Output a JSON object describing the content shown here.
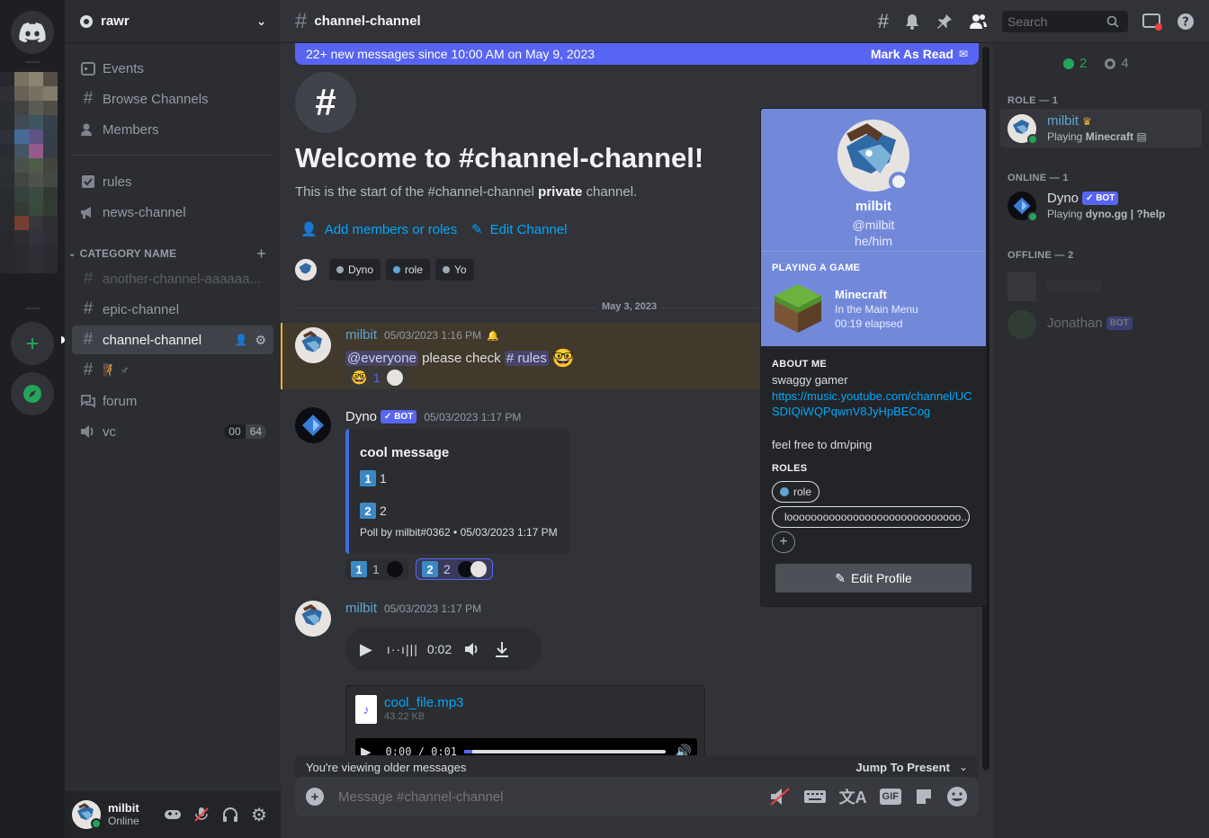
{
  "server": {
    "name": "rawr"
  },
  "sidebar": {
    "top_items": [
      {
        "label": "Events",
        "icon": "calendar-icon"
      },
      {
        "label": "Browse Channels",
        "icon": "browse-channels-icon"
      },
      {
        "label": "Members",
        "icon": "members-icon"
      }
    ],
    "channels": [
      {
        "label": "rules",
        "icon": "rules-icon"
      },
      {
        "label": "news-channel",
        "icon": "announcement-icon"
      }
    ],
    "category": {
      "label": "CATEGORY NAME"
    },
    "category_channels": [
      {
        "label": "another-channel-aaaaaa...",
        "muted": true
      },
      {
        "label": "epic-channel"
      },
      {
        "label": "channel-channel",
        "selected": true
      },
      {
        "label": "🧗 ♂"
      },
      {
        "label": "forum"
      },
      {
        "label": "vc",
        "vc_count": "00",
        "vc_limit": "64"
      }
    ]
  },
  "user_panel": {
    "name": "milbit",
    "status": "Online"
  },
  "topbar": {
    "channel": "channel-channel",
    "search_placeholder": "Search"
  },
  "new_messages_bar": {
    "text": "22+ new messages since 10:00 AM on May 9, 2023",
    "action": "Mark As Read"
  },
  "welcome": {
    "title": "Welcome to #channel-channel!",
    "subtitle_pre": "This is the start of the #channel-channel ",
    "subtitle_bold": "private",
    "subtitle_post": " channel.",
    "add_members": "Add members or roles",
    "edit_channel": "Edit Channel",
    "member_chips": [
      "Dyno",
      "role",
      "Yo"
    ]
  },
  "date_divider": "May 3, 2023",
  "messages": [
    {
      "author": "milbit",
      "timestamp": "05/03/2023 1:16 PM",
      "mention": "@everyone",
      "text": " please check ",
      "channel_link": "rules",
      "reaction_count": "1"
    },
    {
      "author": "Dyno",
      "bot": "BOT",
      "timestamp": "05/03/2023 1:17 PM",
      "embed": {
        "title": "cool message",
        "option1": "1",
        "option2": "2",
        "footer": "Poll by milbit#0362 • 05/03/2023 1:17 PM"
      },
      "reactions": [
        {
          "emoji": "1",
          "count": "1"
        },
        {
          "emoji": "2",
          "count": "2"
        }
      ]
    },
    {
      "author": "milbit",
      "timestamp": "05/03/2023 1:17 PM",
      "voice_time": "0:02",
      "file": {
        "name": "cool_file.mp3",
        "size": "43.22 KB",
        "player_time": "0:00 / 0:01"
      }
    }
  ],
  "older_bar": {
    "text": "You're viewing older messages",
    "action": "Jump To Present"
  },
  "composer": {
    "placeholder": "Message #channel-channel",
    "gif": "GIF"
  },
  "popout": {
    "name": "milbit",
    "handle": "@milbit",
    "pronouns": "he/him",
    "game_header": "PLAYING A GAME",
    "game": "Minecraft",
    "game_state": "In the Main Menu",
    "elapsed": "00:19 elapsed",
    "about_header": "ABOUT ME",
    "about_line1": "swaggy gamer",
    "about_link": "https://music.youtube.com/channel/UCSDIQiWQPqwnV8JyHpBECog",
    "about_line3": "feel free to dm/ping",
    "roles_header": "ROLES",
    "roles": [
      "role",
      "looooooooooooooooooooooooooooo..."
    ],
    "edit_button": "Edit Profile"
  },
  "members": {
    "online_count": "2",
    "offline_count": "4",
    "role_header": "ROLE — 1",
    "online_header": "ONLINE — 1",
    "offline_header": "OFFLINE — 2",
    "role_members": [
      {
        "name": "milbit",
        "activity_pre": "Playing ",
        "activity_bold": "Minecraft"
      }
    ],
    "online_members": [
      {
        "name": "Dyno",
        "bot": "BOT",
        "activity_pre": "Playing ",
        "activity_bold": "dyno.gg | ?help"
      }
    ],
    "offline_members": [
      {
        "name": "Jonathan",
        "bot": "BOT"
      }
    ]
  },
  "colors": {
    "accent": "#5865f2",
    "online": "#23a55a",
    "link": "#00a8fc",
    "profile_banner": "#7289da",
    "role_name": "#5fa6d1"
  }
}
